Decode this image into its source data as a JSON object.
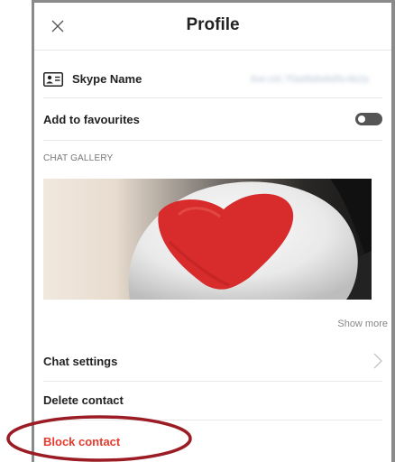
{
  "header": {
    "title": "Profile",
    "close_icon": "close-icon"
  },
  "skype_name": {
    "icon": "contact-card-icon",
    "label": "Skype Name",
    "value": "live:cid.7f3a9b8e6d5c4b2a"
  },
  "favourites": {
    "label": "Add to favourites",
    "toggle_on": false
  },
  "gallery": {
    "label": "CHAT GALLERY",
    "show_more": "Show more"
  },
  "actions": {
    "chat_settings": "Chat settings",
    "delete_contact": "Delete contact",
    "block_contact": "Block contact"
  },
  "colors": {
    "danger": "#e53b2e",
    "annotation": "#9b1c24",
    "toggle_off": "#555555"
  }
}
